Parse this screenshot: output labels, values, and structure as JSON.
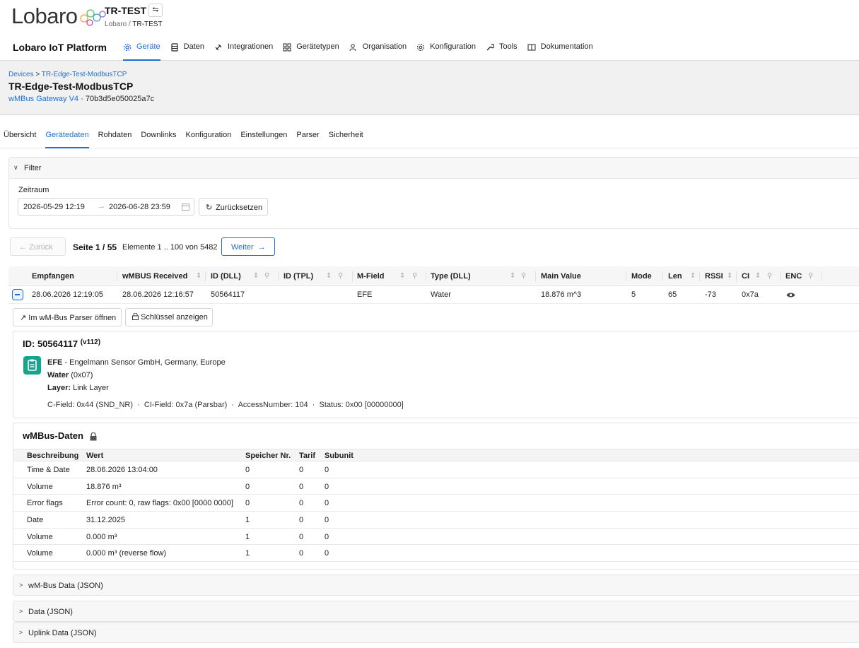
{
  "header": {
    "logo_text": "Lobaro",
    "tenant_title": "TR-TEST",
    "switch_icon": "⇋",
    "tenant_crumb_root": "Lobaro",
    "tenant_crumb_sep": " / ",
    "tenant_crumb_current": "TR-TEST",
    "platform_title": "Lobaro IoT Platform"
  },
  "nav": {
    "items": [
      {
        "label": "Geräte",
        "icon": "gear-icon"
      },
      {
        "label": "Daten",
        "icon": "database-icon"
      },
      {
        "label": "Integrationen",
        "icon": "plug-icon"
      },
      {
        "label": "Gerätetypen",
        "icon": "grid-icon"
      },
      {
        "label": "Organisation",
        "icon": "users-icon"
      },
      {
        "label": "Konfiguration",
        "icon": "cog-icon"
      },
      {
        "label": "Tools",
        "icon": "wrench-icon"
      },
      {
        "label": "Dokumentation",
        "icon": "book-icon"
      }
    ],
    "active_index": 0,
    "accent_color": "#1f6fd1"
  },
  "device": {
    "crumb_root": "Devices",
    "crumb_sep": " > ",
    "crumb_current": "TR-Edge-Test-ModbusTCP",
    "title": "TR-Edge-Test-ModbusTCP",
    "type_link": "wMBus Gateway V4",
    "dot": " · ",
    "address": "70b3d5e050025a7c"
  },
  "tabs": [
    "Übersicht",
    "Gerätedaten",
    "Rohdaten",
    "Downlinks",
    "Konfiguration",
    "Einstellungen",
    "Parser",
    "Sicherheit"
  ],
  "active_tab": 1,
  "filter": {
    "label": "Filter",
    "zeitraum_label": "Zeitraum",
    "date_from": "2026-05-29 12:19",
    "date_arrow": "→",
    "date_to": "2026-06-28 23:59",
    "reset_label": "Zurücksetzen"
  },
  "pager": {
    "prev_label": "Zurück",
    "page_label": "Seite 1 / 55",
    "elements_label": "Elemente 1 .. 100 von 5482",
    "next_label": "Weiter"
  },
  "table": {
    "headers": {
      "empfangen": "Empfangen",
      "wmbus_received": "wMBUS Received",
      "id_dll": "ID (DLL)",
      "id_tpl": "ID (TPL)",
      "m_field": "M-Field",
      "type_dll": "Type (DLL)",
      "main_value": "Main Value",
      "mode": "Mode",
      "len": "Len",
      "rssi": "RSSI",
      "ci": "CI",
      "enc": "ENC"
    },
    "row": {
      "empfangen": "28.06.2026 12:19:05",
      "wmbus_received": "28.06.2026 12:16:57",
      "id_dll": "50564117",
      "id_tpl": "",
      "m_field": "EFE",
      "type_dll": "Water",
      "main_value": "18.876 m^3",
      "mode": "5",
      "len": "65",
      "rssi": "-73",
      "ci": "0x7a"
    }
  },
  "actions": {
    "parser_label": "Im wM-Bus Parser öffnen",
    "key_label": "Schlüssel anzeigen"
  },
  "id_card": {
    "title": "ID: 50564117",
    "version": "(v112)",
    "manufacturer_code": "EFE",
    "manufacturer_desc": " - Engelmann Sensor GmbH, Germany, Europe",
    "type_name": "Water",
    "type_code": " (0x07)",
    "layer_label": "Layer:",
    "layer_value": " Link Layer",
    "fields": "C-Field: 0x44 (SND_NR)  ·  CI-Field: 0x7a (Parsbar)  ·  AccessNumber: 104  ·  Status: 0x00 [00000000]",
    "icon_color": "#1aa38c"
  },
  "wmbus": {
    "title": "wMBus-Daten",
    "headers": {
      "beschreibung": "Beschreibung",
      "wert": "Wert",
      "speicher": "Speicher Nr.",
      "tarif": "Tarif",
      "subunit": "Subunit"
    },
    "rows": [
      {
        "desc": "Time & Date",
        "value": "28.06.2026 13:04:00",
        "storage": "0",
        "tarif": "0",
        "subunit": "0"
      },
      {
        "desc": "Volume",
        "value": "18.876 m³",
        "storage": "0",
        "tarif": "0",
        "subunit": "0"
      },
      {
        "desc": "Error flags",
        "value": "Error count: 0, raw flags: 0x00 [0000 0000]",
        "storage": "0",
        "tarif": "0",
        "subunit": "0"
      },
      {
        "desc": "Date",
        "value": "31.12.2025",
        "storage": "1",
        "tarif": "0",
        "subunit": "0"
      },
      {
        "desc": "Volume",
        "value": "0.000 m³",
        "storage": "1",
        "tarif": "0",
        "subunit": "0"
      },
      {
        "desc": "Volume",
        "value": "0.000 m³ (reverse flow)",
        "storage": "1",
        "tarif": "0",
        "subunit": "0"
      }
    ]
  },
  "collapsibles": [
    "wM-Bus Data (JSON)",
    "Data (JSON)",
    "Uplink Data (JSON)"
  ]
}
